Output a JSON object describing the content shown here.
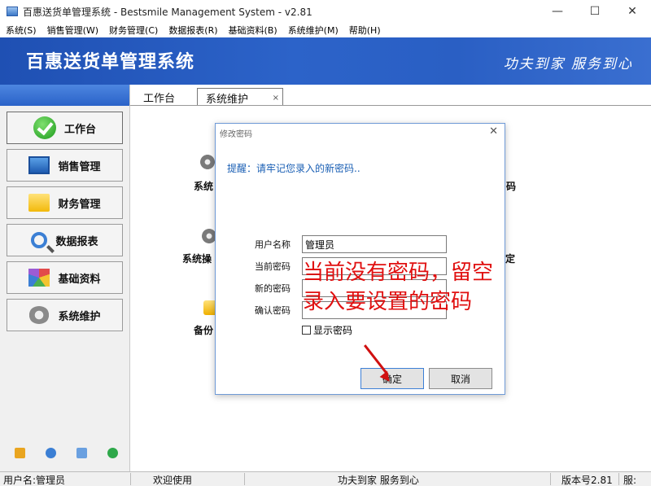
{
  "window": {
    "title": "百惠送货单管理系统 - Bestsmile Management System - v2.81",
    "minimize": "—",
    "maximize": "☐",
    "close": "✕"
  },
  "menu": [
    "系统(S)",
    "销售管理(W)",
    "财务管理(C)",
    "数据报表(R)",
    "基础资料(B)",
    "系统维护(M)",
    "帮助(H)"
  ],
  "banner": {
    "title": "百惠送货单管理系统",
    "slogan": "功夫到家 服务到心"
  },
  "sidebar": {
    "items": [
      {
        "label": "工作台",
        "icon": "check-icon"
      },
      {
        "label": "销售管理",
        "icon": "sales-icon"
      },
      {
        "label": "财务管理",
        "icon": "folder-icon"
      },
      {
        "label": "数据报表",
        "icon": "search-icon"
      },
      {
        "label": "基础资料",
        "icon": "palette-icon"
      },
      {
        "label": "系统维护",
        "icon": "gear-icon"
      }
    ],
    "tools": [
      "key-icon",
      "clock-icon",
      "monitor-icon",
      "back-icon"
    ]
  },
  "tabs": {
    "workbench": "工作台",
    "sysmaint": "系统维护",
    "close": "×"
  },
  "content": {
    "item1": "系统",
    "item2": "系统操",
    "item3": "备份",
    "item4": "码",
    "item5": "定"
  },
  "dialog": {
    "title": "修改密码",
    "close": "✕",
    "hint": "提醒：请牢记您录入的新密码..",
    "username_label": "用户名称",
    "username_value": "管理员",
    "current_label": "当前密码",
    "new_label": "新的密码",
    "confirm_label": "确认密码",
    "show_password": "显示密码",
    "ok": "确定",
    "cancel": "取消"
  },
  "annotation": {
    "line1": "当前没有密码，留空",
    "line2": "录入要设置的密码"
  },
  "status": {
    "user": "用户名:管理员",
    "welcome": "欢迎使用",
    "slogan": "功夫到家 服务到心",
    "version": "版本号2.81",
    "extra": "服:"
  }
}
